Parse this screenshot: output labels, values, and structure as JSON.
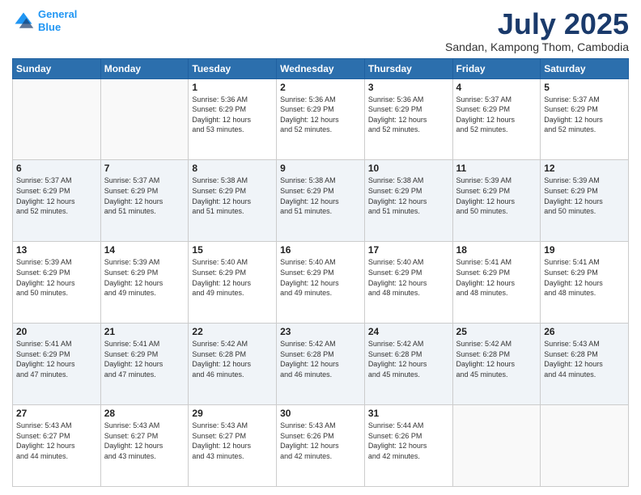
{
  "logo": {
    "line1": "General",
    "line2": "Blue"
  },
  "title": "July 2025",
  "subtitle": "Sandan, Kampong Thom, Cambodia",
  "days_of_week": [
    "Sunday",
    "Monday",
    "Tuesday",
    "Wednesday",
    "Thursday",
    "Friday",
    "Saturday"
  ],
  "weeks": [
    {
      "days": [
        {
          "num": "",
          "info": ""
        },
        {
          "num": "",
          "info": ""
        },
        {
          "num": "1",
          "info": "Sunrise: 5:36 AM\nSunset: 6:29 PM\nDaylight: 12 hours\nand 53 minutes."
        },
        {
          "num": "2",
          "info": "Sunrise: 5:36 AM\nSunset: 6:29 PM\nDaylight: 12 hours\nand 52 minutes."
        },
        {
          "num": "3",
          "info": "Sunrise: 5:36 AM\nSunset: 6:29 PM\nDaylight: 12 hours\nand 52 minutes."
        },
        {
          "num": "4",
          "info": "Sunrise: 5:37 AM\nSunset: 6:29 PM\nDaylight: 12 hours\nand 52 minutes."
        },
        {
          "num": "5",
          "info": "Sunrise: 5:37 AM\nSunset: 6:29 PM\nDaylight: 12 hours\nand 52 minutes."
        }
      ]
    },
    {
      "days": [
        {
          "num": "6",
          "info": "Sunrise: 5:37 AM\nSunset: 6:29 PM\nDaylight: 12 hours\nand 52 minutes."
        },
        {
          "num": "7",
          "info": "Sunrise: 5:37 AM\nSunset: 6:29 PM\nDaylight: 12 hours\nand 51 minutes."
        },
        {
          "num": "8",
          "info": "Sunrise: 5:38 AM\nSunset: 6:29 PM\nDaylight: 12 hours\nand 51 minutes."
        },
        {
          "num": "9",
          "info": "Sunrise: 5:38 AM\nSunset: 6:29 PM\nDaylight: 12 hours\nand 51 minutes."
        },
        {
          "num": "10",
          "info": "Sunrise: 5:38 AM\nSunset: 6:29 PM\nDaylight: 12 hours\nand 51 minutes."
        },
        {
          "num": "11",
          "info": "Sunrise: 5:39 AM\nSunset: 6:29 PM\nDaylight: 12 hours\nand 50 minutes."
        },
        {
          "num": "12",
          "info": "Sunrise: 5:39 AM\nSunset: 6:29 PM\nDaylight: 12 hours\nand 50 minutes."
        }
      ]
    },
    {
      "days": [
        {
          "num": "13",
          "info": "Sunrise: 5:39 AM\nSunset: 6:29 PM\nDaylight: 12 hours\nand 50 minutes."
        },
        {
          "num": "14",
          "info": "Sunrise: 5:39 AM\nSunset: 6:29 PM\nDaylight: 12 hours\nand 49 minutes."
        },
        {
          "num": "15",
          "info": "Sunrise: 5:40 AM\nSunset: 6:29 PM\nDaylight: 12 hours\nand 49 minutes."
        },
        {
          "num": "16",
          "info": "Sunrise: 5:40 AM\nSunset: 6:29 PM\nDaylight: 12 hours\nand 49 minutes."
        },
        {
          "num": "17",
          "info": "Sunrise: 5:40 AM\nSunset: 6:29 PM\nDaylight: 12 hours\nand 48 minutes."
        },
        {
          "num": "18",
          "info": "Sunrise: 5:41 AM\nSunset: 6:29 PM\nDaylight: 12 hours\nand 48 minutes."
        },
        {
          "num": "19",
          "info": "Sunrise: 5:41 AM\nSunset: 6:29 PM\nDaylight: 12 hours\nand 48 minutes."
        }
      ]
    },
    {
      "days": [
        {
          "num": "20",
          "info": "Sunrise: 5:41 AM\nSunset: 6:29 PM\nDaylight: 12 hours\nand 47 minutes."
        },
        {
          "num": "21",
          "info": "Sunrise: 5:41 AM\nSunset: 6:29 PM\nDaylight: 12 hours\nand 47 minutes."
        },
        {
          "num": "22",
          "info": "Sunrise: 5:42 AM\nSunset: 6:28 PM\nDaylight: 12 hours\nand 46 minutes."
        },
        {
          "num": "23",
          "info": "Sunrise: 5:42 AM\nSunset: 6:28 PM\nDaylight: 12 hours\nand 46 minutes."
        },
        {
          "num": "24",
          "info": "Sunrise: 5:42 AM\nSunset: 6:28 PM\nDaylight: 12 hours\nand 45 minutes."
        },
        {
          "num": "25",
          "info": "Sunrise: 5:42 AM\nSunset: 6:28 PM\nDaylight: 12 hours\nand 45 minutes."
        },
        {
          "num": "26",
          "info": "Sunrise: 5:43 AM\nSunset: 6:28 PM\nDaylight: 12 hours\nand 44 minutes."
        }
      ]
    },
    {
      "days": [
        {
          "num": "27",
          "info": "Sunrise: 5:43 AM\nSunset: 6:27 PM\nDaylight: 12 hours\nand 44 minutes."
        },
        {
          "num": "28",
          "info": "Sunrise: 5:43 AM\nSunset: 6:27 PM\nDaylight: 12 hours\nand 43 minutes."
        },
        {
          "num": "29",
          "info": "Sunrise: 5:43 AM\nSunset: 6:27 PM\nDaylight: 12 hours\nand 43 minutes."
        },
        {
          "num": "30",
          "info": "Sunrise: 5:43 AM\nSunset: 6:26 PM\nDaylight: 12 hours\nand 42 minutes."
        },
        {
          "num": "31",
          "info": "Sunrise: 5:44 AM\nSunset: 6:26 PM\nDaylight: 12 hours\nand 42 minutes."
        },
        {
          "num": "",
          "info": ""
        },
        {
          "num": "",
          "info": ""
        }
      ]
    }
  ]
}
